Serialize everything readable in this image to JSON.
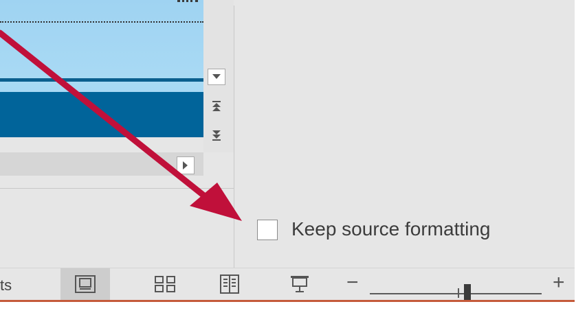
{
  "thumbnail": {
    "accent_color": "#01649a",
    "background_color": "#a6d8f3"
  },
  "scroll_controls": {
    "dropdown_icon": "triangle-down-icon",
    "previous_icon": "double-chevron-up-icon",
    "next_icon": "double-chevron-down-icon",
    "right_icon": "triangle-right-icon"
  },
  "keep_source": {
    "label": "Keep source formatting",
    "checked": false
  },
  "status_bar": {
    "partial_text": "ts",
    "views": [
      {
        "name": "normal-view",
        "icon": "normal-view-icon",
        "active": true
      },
      {
        "name": "slide-sorter-view",
        "icon": "slide-sorter-icon",
        "active": false
      },
      {
        "name": "reading-view",
        "icon": "reading-view-icon",
        "active": false
      },
      {
        "name": "slide-show-view",
        "icon": "slide-show-icon",
        "active": false
      }
    ],
    "zoom_minus": "−",
    "zoom_plus": "+"
  },
  "annotation": {
    "arrow_color": "#c0103a"
  }
}
